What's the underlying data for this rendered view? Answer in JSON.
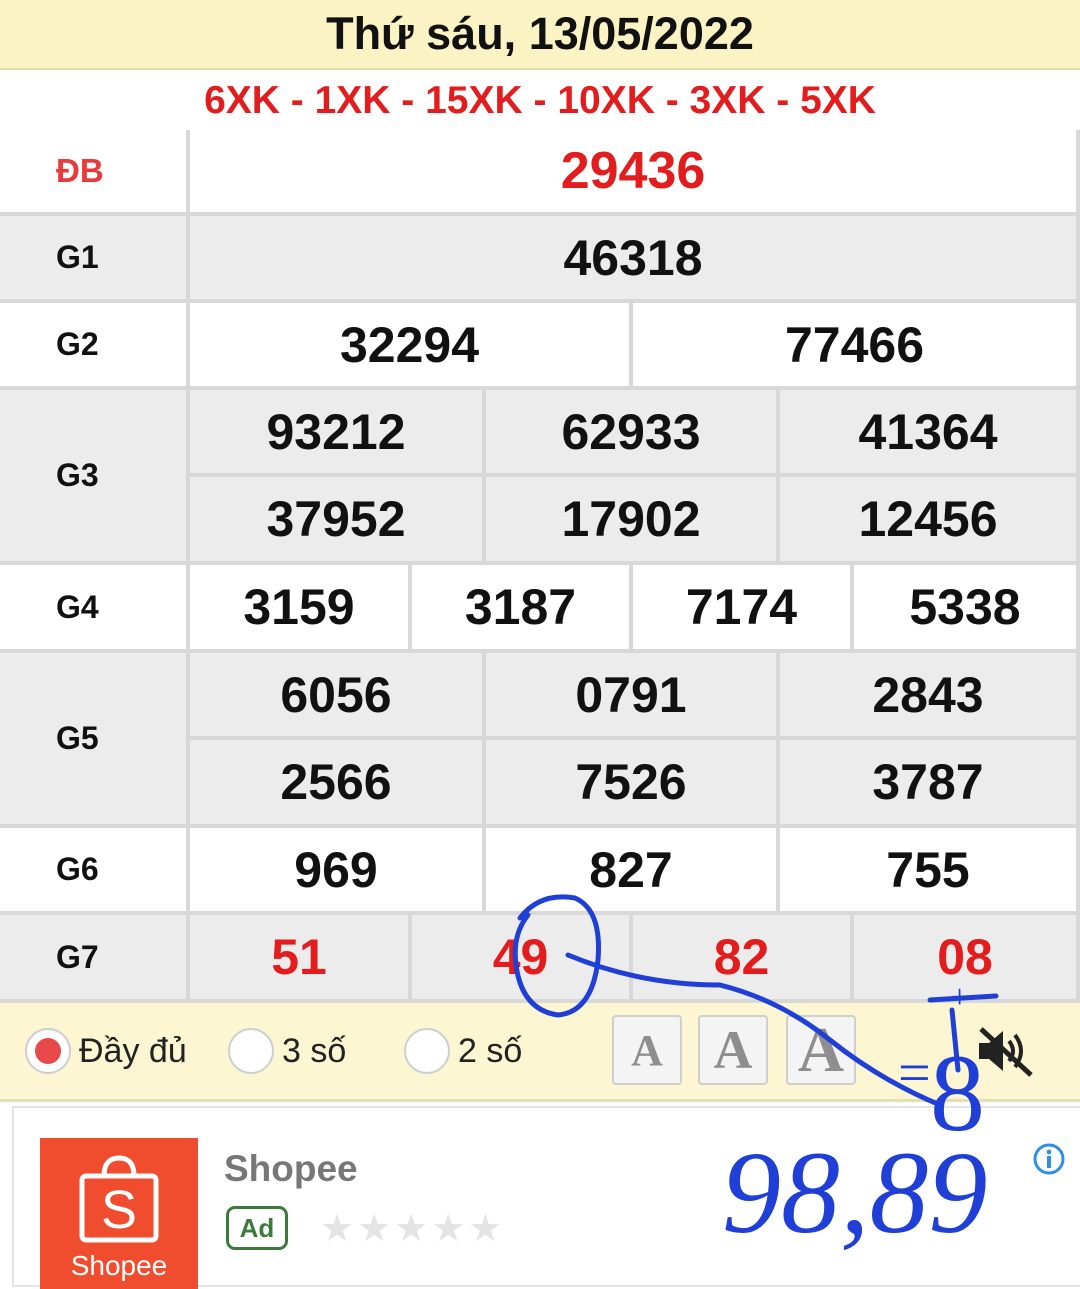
{
  "header": {
    "date": "Thứ sáu, 13/05/2022"
  },
  "codes": {
    "text": "6XK - 1XK - 15XK - 10XK - 3XK - 5XK"
  },
  "results": {
    "db": {
      "label": "ĐB",
      "numbers": [
        "29436"
      ]
    },
    "g1": {
      "label": "G1",
      "numbers": [
        "46318"
      ]
    },
    "g2": {
      "label": "G2",
      "numbers": [
        "32294",
        "77466"
      ]
    },
    "g3": {
      "label": "G3",
      "numbers": [
        "93212",
        "62933",
        "41364",
        "37952",
        "17902",
        "12456"
      ]
    },
    "g4": {
      "label": "G4",
      "numbers": [
        "3159",
        "3187",
        "7174",
        "5338"
      ]
    },
    "g5": {
      "label": "G5",
      "numbers": [
        "6056",
        "0791",
        "2843",
        "2566",
        "7526",
        "3787"
      ]
    },
    "g6": {
      "label": "G6",
      "numbers": [
        "969",
        "827",
        "755"
      ]
    },
    "g7": {
      "label": "G7",
      "numbers": [
        "51",
        "49",
        "82",
        "08"
      ]
    }
  },
  "options": {
    "radios": [
      {
        "label": "Đầy đủ",
        "selected": true
      },
      {
        "label": "3 số",
        "selected": false
      },
      {
        "label": "2 số",
        "selected": false
      }
    ],
    "font_buttons": [
      "A",
      "A",
      "A"
    ]
  },
  "ad": {
    "app_name": "Shopee",
    "logo_text": "Shopee",
    "logo_glyph": "S",
    "badge": "Ad",
    "stars": "★★★★★",
    "rating_stars_filled": 0
  },
  "annotations": {
    "handwritten_equals": "=",
    "handwritten_eight": "8",
    "handwritten_plus": "+",
    "handwritten_numbers": "98,89"
  },
  "colors": {
    "accent_red": "#e31d1d",
    "header_bg": "#fcf3c4",
    "row_gray": "#ececec",
    "ink_blue": "#1f3fd6",
    "shopee_orange": "#ef4d2d",
    "ad_green": "#3b7a3b"
  },
  "icons": {
    "mute": "speaker-muted-icon",
    "info": "info-icon",
    "shopee": "shopping-bag-icon"
  }
}
